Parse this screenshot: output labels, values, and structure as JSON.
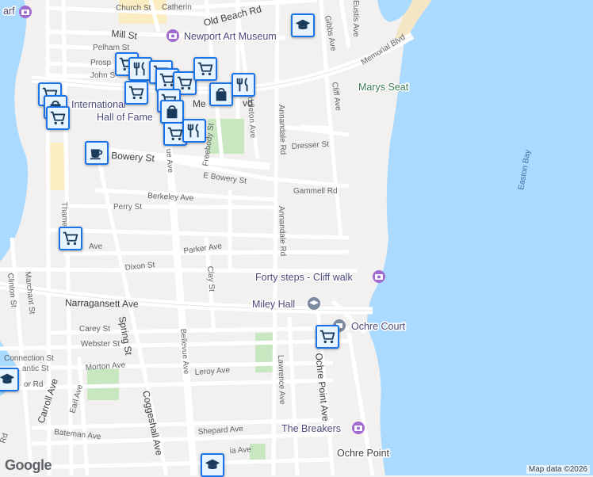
{
  "map": {
    "streets": {
      "church": "Church St",
      "catherine": "Catherin",
      "old_beach": "Old Beach Rd",
      "mill": "Mill St",
      "pelham": "Pelham St",
      "prospect": "Prosp",
      "john": "John S",
      "memorial": "Memorial Blvd",
      "gibbs": "Gibbs Ave",
      "eustis": "Eustis Ave",
      "cliff": "Cliff Ave",
      "menlo": "Me",
      "vd": "vd",
      "dresser": "Dresser St",
      "peabody": "Freebody St",
      "middleton": "Middleton Ave",
      "annandale1": "Annandale Rd",
      "annandale2": "Annandale Rd",
      "bowery": "Bowery St",
      "e_bowery": "E Bowery St",
      "gammell": "Gammell Rd",
      "berkeley": "Berkeley Ave",
      "perry": "Perry St",
      "bellevue": "ue Ave",
      "bellevue2": "Bellevue Ave",
      "thames": "Thame",
      "ave_small": "Ave",
      "parker": "Parker Ave",
      "dixon": "Dixon St",
      "clay": "Clay St",
      "clinton": "Clinton St",
      "marchant": "Marchant St",
      "narragansett": "Narragansett Ave",
      "spring": "Spring St",
      "carey": "Carey St",
      "webster": "Webster St",
      "connection": "Connection St",
      "antic": "antic St",
      "morton": "Morton Ave",
      "carroll": "Carroll Ave",
      "or_rd": "or Rd",
      "leroy": "Leroy Ave",
      "lawrence": "Lawrence Ave",
      "ochre_point_ave": "Ochre Point Ave",
      "earl": "Earl Ave",
      "coggeshall": "Coggeshall Ave",
      "bateman": "Bateman Ave",
      "shepard": "Shepard Ave",
      "ia_ave": "ia Ave",
      "rd": "Rd"
    },
    "pois": {
      "art_museum": "Newport Art Museum",
      "international": "International",
      "hall_of_fame": "Hall of Fame",
      "marys_seat": "Marys Seat",
      "forty_steps": "Forty steps - Cliff walk",
      "miley_hall": "Miley Hall",
      "ochre_court": "Ochre Court",
      "the_breakers": "The Breakers",
      "ochre_point": "Ochre Point",
      "easton_bay": "Easton Bay",
      "arf": "arf"
    },
    "colors": {
      "water": "#aadaff",
      "land": "#f2f1ef",
      "park": "#c8e6c0",
      "major_road": "#ffffff",
      "marker_border": "#1a73e8"
    },
    "markers": [
      "shopping-cart-icon",
      "restaurant-icon",
      "shopping-bag-icon",
      "coffee-icon",
      "school-icon",
      "camera-icon"
    ]
  },
  "footer": {
    "logo": "Google",
    "attribution": "Map data ©2026"
  }
}
